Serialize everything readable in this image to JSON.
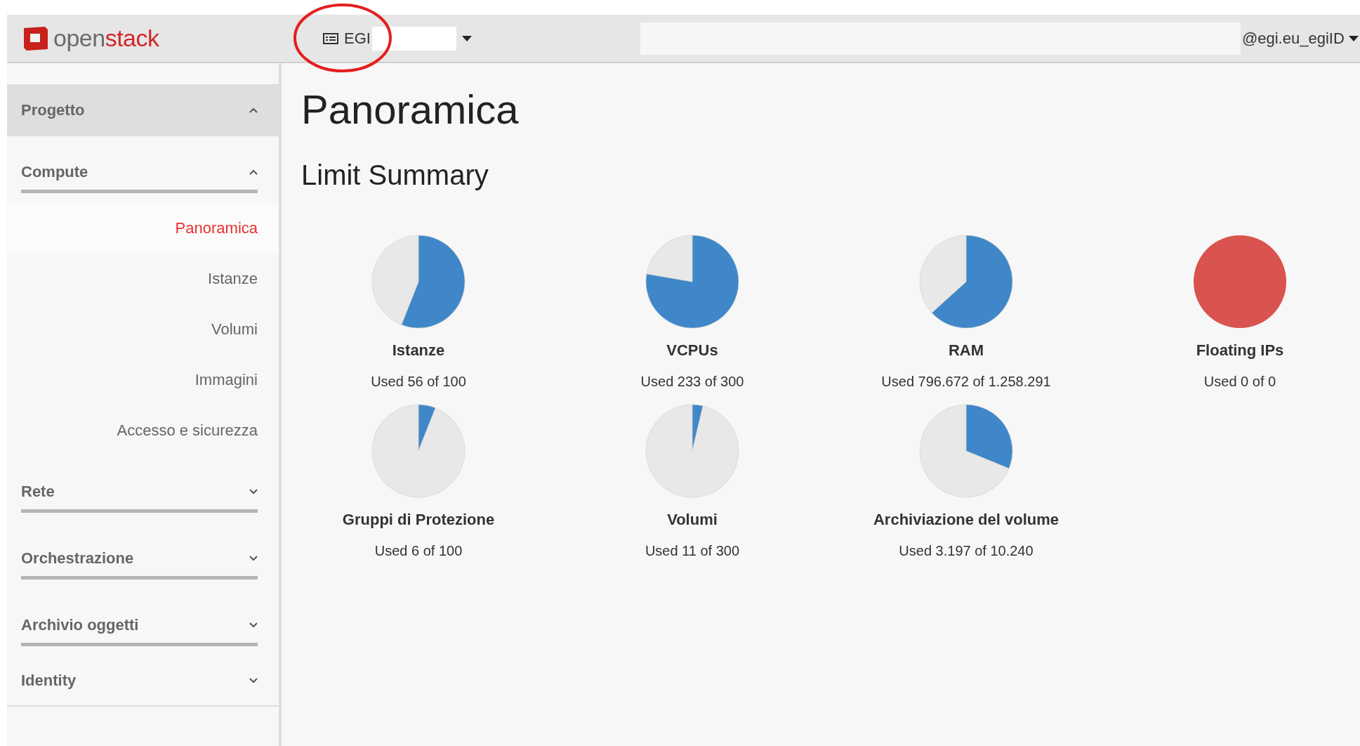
{
  "header": {
    "logo": {
      "prefix": "open",
      "suffix": "stack"
    },
    "project": {
      "label": "EGI"
    },
    "user": {
      "label": "@egi.eu_egiID"
    }
  },
  "sidebar": {
    "sections": [
      {
        "label": "Progetto",
        "expanded": true,
        "children": [
          {
            "label": "Compute",
            "expanded": true,
            "items": [
              {
                "label": "Panoramica",
                "selected": true
              },
              {
                "label": "Istanze",
                "selected": false
              },
              {
                "label": "Volumi",
                "selected": false
              },
              {
                "label": "Immagini",
                "selected": false
              },
              {
                "label": "Accesso e sicurezza",
                "selected": false
              }
            ]
          },
          {
            "label": "Rete",
            "expanded": false
          },
          {
            "label": "Orchestrazione",
            "expanded": false
          },
          {
            "label": "Archivio oggetti",
            "expanded": false
          }
        ]
      },
      {
        "label": "Identity",
        "expanded": false
      }
    ]
  },
  "page": {
    "title": "Panoramica",
    "subtitle": "Limit Summary"
  },
  "quotas": [
    {
      "name": "Istanze",
      "usage": "Used 56 of 100",
      "kind": "pie",
      "chart_data": {
        "type": "pie",
        "values": [
          56,
          44
        ]
      }
    },
    {
      "name": "VCPUs",
      "usage": "Used 233 of 300",
      "kind": "pie",
      "chart_data": {
        "type": "pie",
        "values": [
          77.7,
          22.3
        ]
      }
    },
    {
      "name": "RAM",
      "usage": "Used 796.672 of 1.258.291",
      "kind": "pie",
      "chart_data": {
        "type": "pie",
        "values": [
          63.3,
          36.7
        ]
      }
    },
    {
      "name": "Floating IPs",
      "usage": "Used 0 of 0",
      "kind": "exhausted"
    },
    {
      "name": "Gruppi di Protezione",
      "usage": "Used 6 of 100",
      "kind": "pie",
      "chart_data": {
        "type": "pie",
        "values": [
          6,
          94
        ]
      }
    },
    {
      "name": "Volumi",
      "usage": "Used 11 of 300",
      "kind": "pie",
      "chart_data": {
        "type": "pie",
        "values": [
          3.7,
          96.3
        ]
      }
    },
    {
      "name": "Archiviazione del volume",
      "usage": "Used 3.197 of 10.240",
      "kind": "pie",
      "chart_data": {
        "type": "pie",
        "values": [
          31.2,
          68.8
        ]
      }
    }
  ]
}
